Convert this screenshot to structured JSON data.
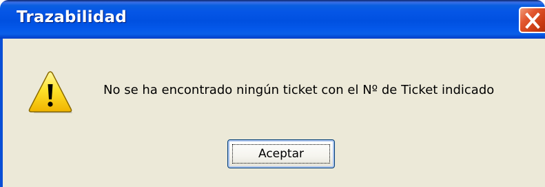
{
  "window": {
    "title": "Trazabilidad",
    "close_icon": "close-icon"
  },
  "dialog": {
    "icon": "warning-icon",
    "message": "No se ha encontrado ningún ticket con el Nº de Ticket indicado",
    "ok_label": "Aceptar"
  },
  "colors": {
    "titlebar": "#0055e5",
    "close_button": "#d9532b",
    "client_background": "#ece9d8",
    "warning_yellow": "#ffd800"
  }
}
